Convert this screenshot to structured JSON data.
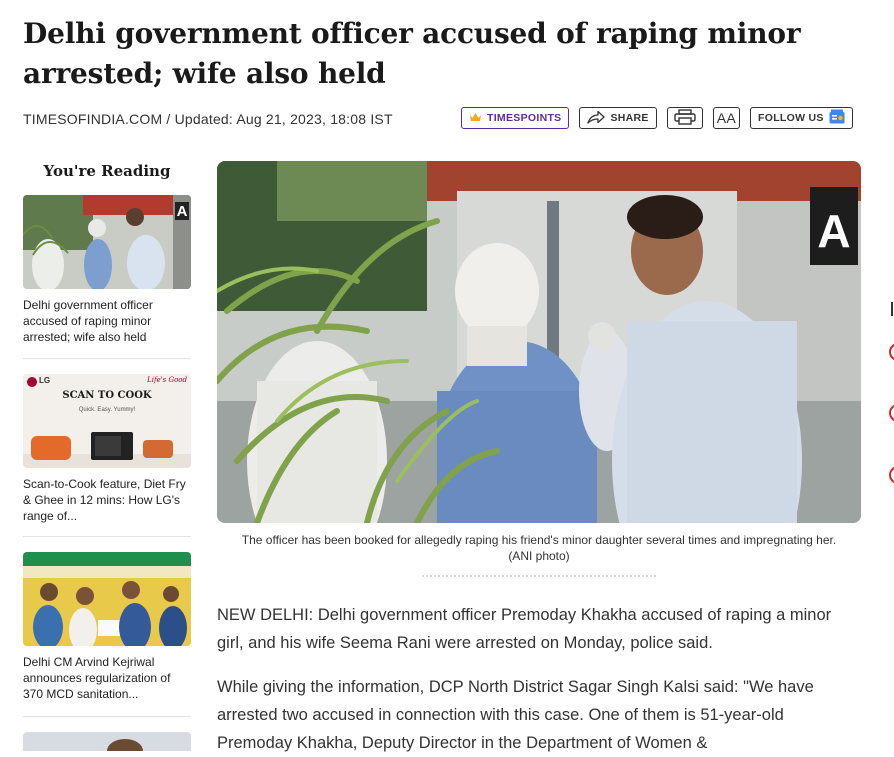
{
  "article": {
    "headline": "Delhi government officer accused of raping minor arrested; wife also held",
    "byline": "TIMESOFINDIA.COM / Updated: Aug 21, 2023, 18:08 IST",
    "image_caption": "The officer has been booked for allegedly raping his friend's minor daughter several times and impregnating her. (ANI photo)",
    "paragraphs": [
      "NEW DELHI: Delhi government officer Premoday Khakha accused of raping a minor girl, and his wife Seema Rani were arrested on Monday, police said.",
      "While giving the information, DCP North District Sagar Singh Kalsi said: \"We have arrested two accused in connection with this case. One of them is 51-year-old Premoday Khakha, Deputy Director in the Department of Women &"
    ]
  },
  "actions": {
    "timespoints": "TIMESPOINTS",
    "share": "SHARE",
    "font_size": "AA",
    "follow_us": "FOLLOW US"
  },
  "sidebar": {
    "title": "You're Reading",
    "items": [
      {
        "text": "Delhi government officer accused of raping minor arrested; wife also held"
      },
      {
        "text": "Scan-to-Cook feature, Diet Fry & Ghee in 12 mins: How LG's range of...",
        "ad_brand": "LG",
        "ad_title": "SCAN TO COOK",
        "ad_tagline": "Quick. Easy. Yummy!",
        "ad_slogan": "Life's Good"
      },
      {
        "text": "Delhi CM Arvind Kejriwal announces regularization of 370 MCD sanitation..."
      }
    ]
  },
  "hero_watermark": "A",
  "colors": {
    "timespoints": "#5b2ca0",
    "lg_red": "#a50034",
    "text": "#1a1a1a"
  }
}
